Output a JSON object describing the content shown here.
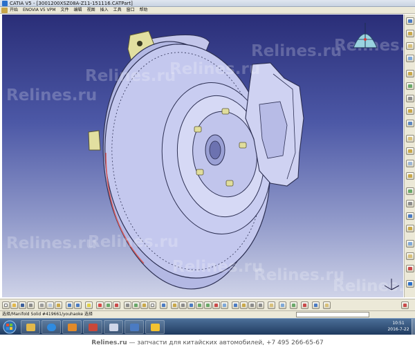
{
  "window": {
    "title": "CATIA V5 - [3001200XSZ08A-Z11-151116.CATPart]"
  },
  "menubar": {
    "items": [
      "开始",
      "ENOVIA V5 VPM",
      "文件",
      "编辑",
      "视图",
      "插入",
      "工具",
      "窗口",
      "帮助"
    ]
  },
  "viewport": {
    "watermark_text": "Relines.ru",
    "background_top": "#2a2e78",
    "background_bottom": "#cfd3e8",
    "part_color": "#b9bde6",
    "edge_color": "#2c2f52",
    "bracket_color": "#e2dfa0"
  },
  "statusbar": {
    "text": "选择/Manifold Solid #419661/youhaoke 选择"
  },
  "taskbar": {
    "clock_time": "10:51",
    "clock_date": "2016-7-22",
    "apps": [
      "windows-explorer",
      "internet-explorer",
      "media-player",
      "presentation",
      "catia",
      "pinyin-ime"
    ]
  },
  "footer": {
    "site": "Relines.ru",
    "tagline": " — запчасти для китайских автомобилей, +7 495 266-65-67"
  },
  "icons": {
    "compass": "compass-icon",
    "axis": "axis-triad-icon",
    "start": "windows-start-icon"
  }
}
